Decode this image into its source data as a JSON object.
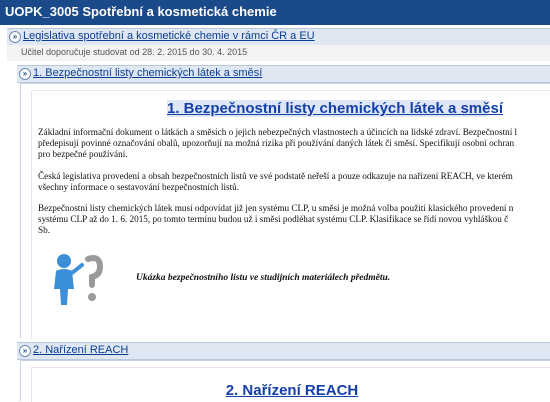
{
  "window": {
    "title": "UOPK_3005 Spotřební a kosmetická chemie"
  },
  "breadcrumb": {
    "label": "Legislativa spotřební a kosmetické chemie v rámci ČR a EU"
  },
  "notice": {
    "text": "Učitel doporučuje studovat od 28. 2. 2015 do 30. 4. 2015"
  },
  "sections": [
    {
      "label": "1. Bezpečnostní listy chemických látek a směsí",
      "heading": "1. Bezpečnostní listy chemických látek a směsí",
      "paragraphs": [
        {
          "lines": [
            "Základní informační dokument o látkách a směsích o jejich nebezpečných vlastnostech a účincích na lidské zdraví. Bezpečnostní l",
            "předepisují povinné označování obalů, upozorňují na možná rizika při používání daných látek či směsí. Specifikují osobní ochran",
            "pro bezpečné používání."
          ]
        },
        {
          "lines": [
            "Česká legislativa provedení a obsah bezpečnostních listů ve své podstatě neřeší a pouze odkazuje na nařízení REACH, ve kterém",
            "všechny informace o sestavování bezpečnostních listů."
          ]
        },
        {
          "lines": [
            "Bezpečnostní listy chemických látek musí odpovídat již jen systému CLP, u směsí je možná volba použití klasického provedení n",
            "systému CLP až do 1. 6. 2015, po tomto termínu budou už i směsi podléhat systému CLP. Klasifikace se řídí novou vyhláškou č",
            "Sb."
          ]
        }
      ],
      "figure_caption": "Ukázka bezpečnostního listu ve studijních materiálech předmětu."
    },
    {
      "label": "2. Nařízení REACH",
      "heading": "2. Nařízení REACH"
    }
  ],
  "colors": {
    "header_bg": "#1a4a8a",
    "section_bar_bg": "#dfe8f2",
    "link": "#0b3d91",
    "heading": "#1440a8"
  },
  "icons": {
    "section_toggle": "double-chevron-icon",
    "figure": "person-question-mark-icon"
  }
}
